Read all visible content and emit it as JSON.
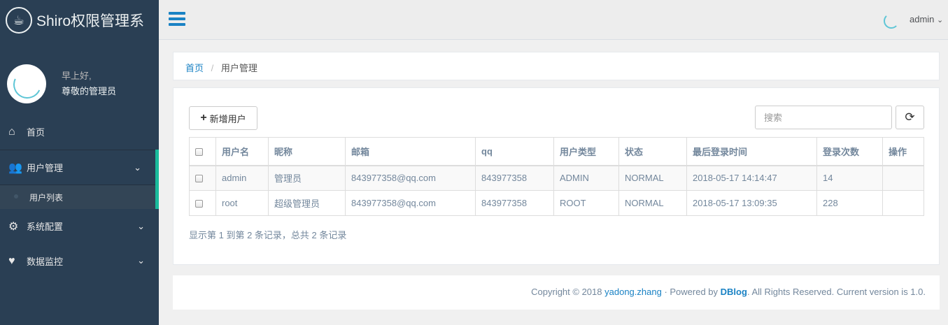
{
  "brand": {
    "title": "Shiro权限管理系",
    "logo_icon": "coffee-cup-icon"
  },
  "profile": {
    "greeting": "早上好,",
    "name": "尊敬的管理员"
  },
  "sidebar": {
    "items": [
      {
        "label": "首页",
        "icon": "home-icon"
      },
      {
        "label": "用户管理",
        "icon": "users-icon",
        "expanded": true,
        "sub": [
          {
            "label": "用户列表"
          }
        ]
      },
      {
        "label": "系统配置",
        "icon": "gears-icon"
      },
      {
        "label": "数据监控",
        "icon": "heartbeat-icon"
      }
    ]
  },
  "topbar": {
    "user": "admin"
  },
  "breadcrumb": {
    "home": "首页",
    "current": "用户管理"
  },
  "toolbar": {
    "add_label": "新增用户",
    "search_placeholder": "搜索"
  },
  "table": {
    "headers": [
      "用户名",
      "昵称",
      "邮箱",
      "qq",
      "用户类型",
      "状态",
      "最后登录时间",
      "登录次数",
      "操作"
    ],
    "rows": [
      [
        "admin",
        "管理员",
        "843977358@qq.com",
        "843977358",
        "ADMIN",
        "NORMAL",
        "2018-05-17 14:14:47",
        "14",
        ""
      ],
      [
        "root",
        "超级管理员",
        "843977358@qq.com",
        "843977358",
        "ROOT",
        "NORMAL",
        "2018-05-17 13:09:35",
        "228",
        ""
      ]
    ]
  },
  "pager": {
    "info": "显示第 1 到第 2 条记录，总共 2 条记录"
  },
  "footer": {
    "copyright": "Copyright © 2018",
    "author": "yadong.zhang",
    "powered": "· Powered by",
    "product": "DBlog",
    "rest": ". All Rights Reserved. Current version is 1.0."
  },
  "colors": {
    "sidebar_bg": "#2a3f54",
    "accent": "#1abb9c",
    "link": "#1a82c4"
  }
}
